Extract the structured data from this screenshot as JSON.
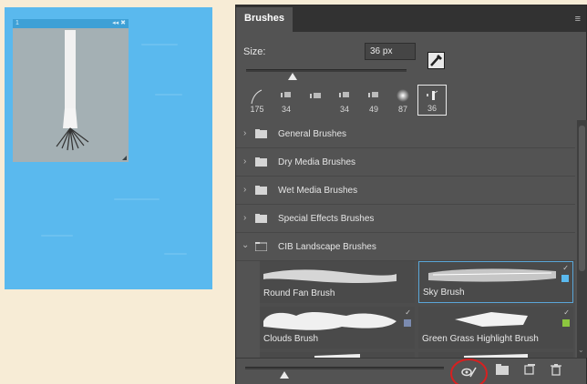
{
  "canvas": {
    "preview_title_left": "1",
    "preview_title_right": "◂◂ ✖"
  },
  "panel": {
    "tab_label": "Brushes",
    "menu_icon": "menu-lines-icon",
    "size_label": "Size:",
    "size_value": "36 px",
    "size_slider_fraction": 0.32,
    "presets": [
      {
        "label": "175",
        "icon": "stroke-brush-icon"
      },
      {
        "label": "34",
        "icon": "tip-brush-icon"
      },
      {
        "label": "",
        "icon": "tip-brush-icon"
      },
      {
        "label": "34",
        "icon": "tip-brush-icon"
      },
      {
        "label": "49",
        "icon": "tip-brush-icon"
      },
      {
        "label": "87",
        "icon": "soft-round-brush-icon"
      },
      {
        "label": "36",
        "icon": "fan-brush-icon",
        "selected": true
      }
    ],
    "groups": [
      {
        "label": "General Brushes",
        "expanded": false
      },
      {
        "label": "Dry Media Brushes",
        "expanded": false
      },
      {
        "label": "Wet Media Brushes",
        "expanded": false
      },
      {
        "label": "Special Effects Brushes",
        "expanded": false
      },
      {
        "label": "CIB Landscape Brushes",
        "expanded": true
      }
    ],
    "brush_tiles": [
      {
        "label": "Round Fan Brush",
        "selected": false,
        "swatch": ""
      },
      {
        "label": "Sky Brush",
        "selected": true,
        "swatch": "#5ab9ee"
      },
      {
        "label": "Clouds Brush",
        "selected": false,
        "swatch": "#7b8bb0"
      },
      {
        "label": "Green Grass Highlight Brush",
        "selected": false,
        "swatch": "#8cc63f"
      }
    ],
    "bottom_slider_fraction": 0.18,
    "bottom_icons": [
      "visibility-toggle-icon",
      "new-group-folder-icon",
      "new-brush-icon",
      "trash-icon"
    ]
  },
  "colors": {
    "canvas_blue": "#5ab9ee",
    "panel_gray": "#535353",
    "selection_blue": "#5aa6d8",
    "highlight_red": "#d82020"
  }
}
